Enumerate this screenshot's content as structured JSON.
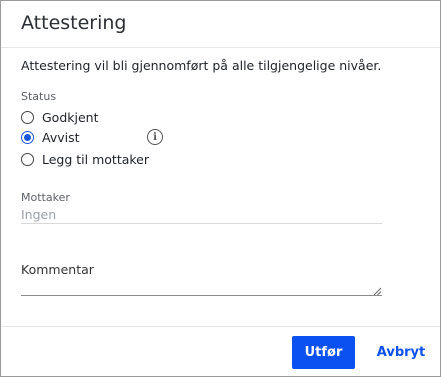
{
  "dialog": {
    "title": "Attestering",
    "description": "Attestering vil bli gjennomført på alle tilgjengelige nivåer."
  },
  "status": {
    "label": "Status",
    "options": [
      {
        "label": "Godkjent",
        "checked": false
      },
      {
        "label": "Avvist",
        "checked": true
      },
      {
        "label": "Legg til mottaker",
        "checked": false
      }
    ],
    "info_icon": "info-icon"
  },
  "recipient": {
    "label": "Mottaker",
    "value": "Ingen"
  },
  "comment": {
    "label": "Kommentar",
    "value": ""
  },
  "actions": {
    "submit_label": "Utfør",
    "cancel_label": "Avbryt"
  },
  "colors": {
    "accent": "#0b50f0"
  }
}
